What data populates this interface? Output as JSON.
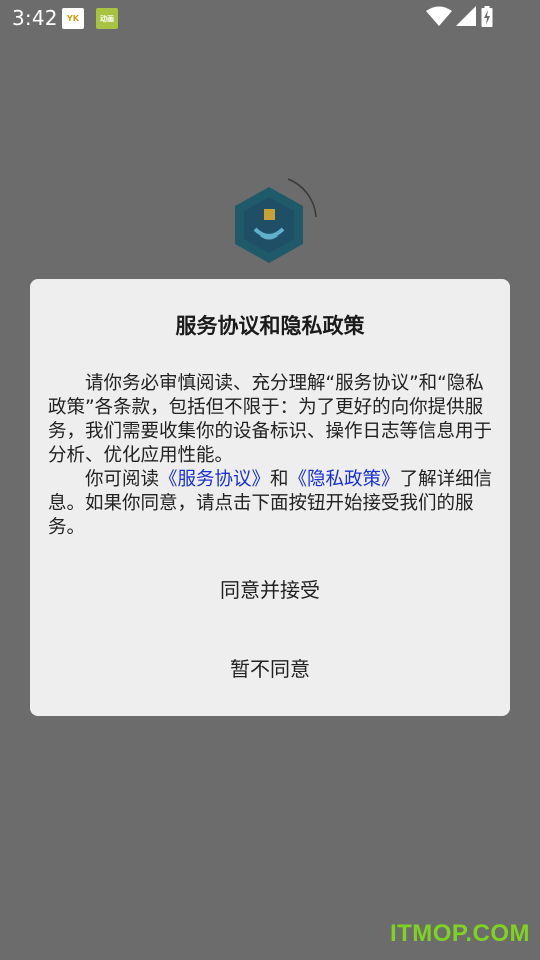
{
  "status_bar": {
    "time": "3:42",
    "notification_icons": [
      "app-notification-icon",
      "app-notification-icon"
    ],
    "notif1_text": "YK",
    "notif2_text": "动画"
  },
  "dialog": {
    "title": "服务协议和隐私政策",
    "paragraph1": "请你务必审慎阅读、充分理解“服务协议”和“隐私政策”各条款，包括但不限于：为了更好的向你提供服务，我们需要收集你的设备标识、操作日志等信息用于分析、优化应用性能。",
    "p2_prefix": "你可阅读",
    "link_service": "《服务协议》",
    "p2_and": "和",
    "link_privacy": "《隐私政策》",
    "p2_suffix": "了解详细信息。如果你同意，请点击下面按钮开始接受我们的服务。",
    "agree_label": "同意并接受",
    "decline_label": "暂不同意"
  },
  "watermark": "ITMOP.COM",
  "colors": {
    "overlay": "#6c6c6c",
    "dialog_bg": "#eeeeee",
    "link": "#1a30d6",
    "watermark": "#7ed321"
  }
}
